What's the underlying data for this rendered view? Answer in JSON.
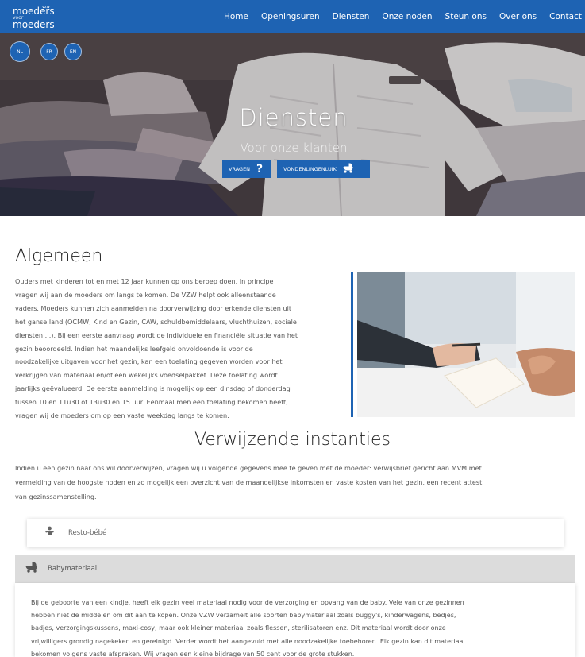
{
  "nav": {
    "logo": {
      "line1": "moeders",
      "line2": "voor",
      "line3": "moeders",
      "vzw": "vzw"
    },
    "links": [
      "Home",
      "Openingsuren",
      "Diensten",
      "Onze noden",
      "Steun ons",
      "Over ons",
      "Contact"
    ]
  },
  "hero": {
    "languages": [
      "NL",
      "FR",
      "EN"
    ],
    "title": "Diensten",
    "subtitle": "Voor onze klanten",
    "buttons": [
      {
        "label": "VRAGEN",
        "icon": "question-icon"
      },
      {
        "label": "VONDENLINGENLUIK",
        "icon": "stroller-icon"
      }
    ]
  },
  "algemeen": {
    "heading": "Algemeen",
    "lines": [
      "Ouders met kinderen tot en met 12 jaar kunnen op ons beroep doen. In principe",
      "vragen wij aan de moeders om langs te komen. De VZW helpt ook alleenstaande",
      "vaders. Moeders kunnen zich aanmelden na doorverwijzing door erkende diensten uit",
      "het ganse land (OCMW, Kind en Gezin, CAW, schuldbemiddelaars, vluchthuizen, sociale",
      "diensten ...). Bij een eerste aanvraag wordt de individuele en financiële situatie van het",
      "gezin beoordeeld. Indien het maandelijks leefgeld onvoldoende is voor de",
      "noodzakelijke uitgaven voor het gezin, kan een toelating gegeven worden voor het",
      "verkrijgen van materiaal en/of een wekelijks voedselpakket. Deze toelating wordt",
      "jaarlijks geëvalueerd. De eerste aanmelding is mogelijk op een dinsdag of donderdag",
      "tussen 10 en 11u30 of 13u30 en 15 uur. Eenmaal men een toelating bekomen heeft,",
      "vragen wij de moeders om op een vaste weekdag langs te komen."
    ]
  },
  "verwijzende": {
    "heading": "Verwijzende instanties",
    "lines": [
      "Indien u een gezin naar ons wil doorverwijzen, vragen wij u volgende gegevens mee te geven met de moeder: verwijsbrief gericht aan MVM met",
      "vermelding van de hoogste noden en zo mogelijk een overzicht van de maandelijkse inkomsten en vaste kosten van het gezin, een recent attest",
      "van gezinssamenstelling."
    ]
  },
  "accordion": {
    "items": [
      {
        "label": "Resto-bébé",
        "icon": "baby-icon"
      },
      {
        "label": "Babymateriaal",
        "icon": "stroller-icon"
      }
    ],
    "body_lines": [
      "Bij de geboorte van een kindje, heeft elk gezin veel materiaal nodig voor de verzorging en opvang van de baby. Vele van onze gezinnen",
      "hebben niet de middelen om dit aan te kopen. Onze VZW verzamelt alle soorten babymateriaal zoals buggy's, kinderwagens, bedjes,",
      "badjes, verzorgingskussens, maxi-cosy, maar ook kleiner materiaal zoals flessen, sterilisatoren enz. Dit materiaal wordt door onze",
      "vrijwilligers grondig nagekeken en gereinigd. Verder wordt het aangevuld met alle noodzakelijke toebehoren. Elk gezin kan dit materiaal",
      "bekomen volgens vaste afspraken. Wij vragen een kleine bijdrage van 50 cent voor de grote stukken."
    ]
  },
  "colors": {
    "primary": "#1e63b3",
    "accordion_active": "#dcdcdc"
  }
}
